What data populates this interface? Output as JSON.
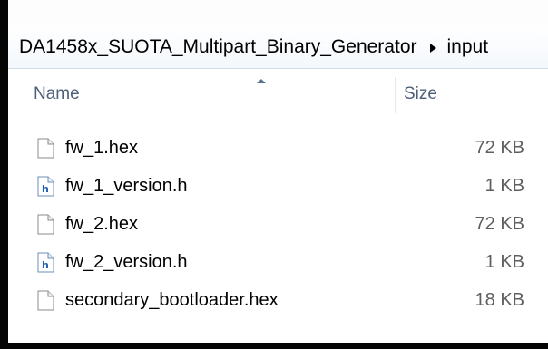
{
  "address": {
    "folder": "DA1458x_SUOTA_Multipart_Binary_Generator",
    "subfolder": "input"
  },
  "columns": {
    "name": "Name",
    "size": "Size"
  },
  "files": [
    {
      "name": "fw_1.hex",
      "size": "72 KB",
      "icon": "blank-file-icon"
    },
    {
      "name": "fw_1_version.h",
      "size": "1 KB",
      "icon": "header-file-icon"
    },
    {
      "name": "fw_2.hex",
      "size": "72 KB",
      "icon": "blank-file-icon"
    },
    {
      "name": "fw_2_version.h",
      "size": "1 KB",
      "icon": "header-file-icon"
    },
    {
      "name": "secondary_bootloader.hex",
      "size": "18 KB",
      "icon": "blank-file-icon"
    }
  ],
  "colors": {
    "frame": "#050505",
    "header_text": "#4c607a",
    "size_text": "#5f5f5f",
    "header_icon_letter": "#1f5fb4"
  }
}
